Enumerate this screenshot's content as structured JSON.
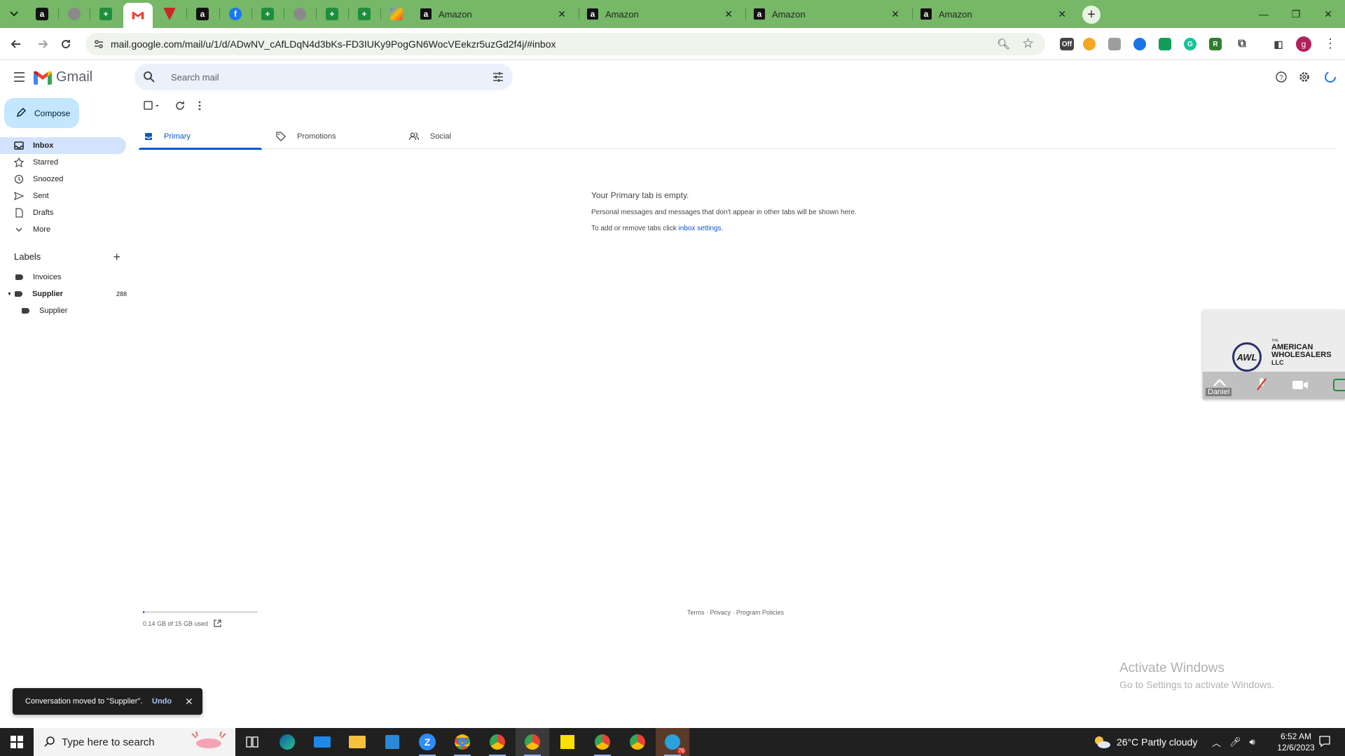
{
  "browser": {
    "pinned_tabs": [
      {
        "icon": "amazon-icon"
      },
      {
        "icon": "globe-icon"
      },
      {
        "icon": "sheets-plus-icon"
      },
      {
        "icon": "gmail-icon",
        "active": true
      },
      {
        "icon": "red-shield-icon"
      },
      {
        "icon": "amazon-icon"
      },
      {
        "icon": "facebook-icon"
      },
      {
        "icon": "sheets-plus-icon"
      },
      {
        "icon": "globe-icon"
      },
      {
        "icon": "sheets-plus-icon"
      },
      {
        "icon": "sheets-plus-icon"
      },
      {
        "icon": "colorful-app-icon"
      }
    ],
    "tabs": [
      {
        "title": "Amazon"
      },
      {
        "title": "Amazon"
      },
      {
        "title": "Amazon"
      },
      {
        "title": "Amazon"
      }
    ],
    "url": "mail.google.com/mail/u/1/d/ADwNV_cAfLDqN4d3bKs-FD3IUKy9PogGN6WocVEekzr5uzGd2f4j/#inbox",
    "profile_initial": "g",
    "accent_color": "#76b768"
  },
  "gmail": {
    "logo_text": "Gmail",
    "search_placeholder": "Search mail",
    "compose_label": "Compose",
    "nav": [
      {
        "label": "Inbox",
        "icon": "inbox-icon",
        "active": true
      },
      {
        "label": "Starred",
        "icon": "star-icon"
      },
      {
        "label": "Snoozed",
        "icon": "clock-icon"
      },
      {
        "label": "Sent",
        "icon": "send-icon"
      },
      {
        "label": "Drafts",
        "icon": "draft-icon"
      },
      {
        "label": "More",
        "icon": "chevron-down-icon"
      }
    ],
    "labels_title": "Labels",
    "labels": [
      {
        "name": "Invoices"
      },
      {
        "name": "Supplier",
        "count": "288",
        "bold": true,
        "expanded": true
      },
      {
        "name": "Supplier",
        "child": true
      }
    ],
    "tabs": [
      {
        "label": "Primary",
        "icon": "inbox-icon",
        "active": true
      },
      {
        "label": "Promotions",
        "icon": "tag-icon"
      },
      {
        "label": "Social",
        "icon": "people-icon"
      }
    ],
    "empty": {
      "title": "Your Primary tab is empty.",
      "line1": "Personal messages and messages that don't appear in other tabs will be shown here.",
      "line2_prefix": "To add or remove tabs click ",
      "line2_link": "inbox settings",
      "line2_suffix": "."
    },
    "storage": {
      "text": "0.14 GB of 15 GB used",
      "fraction": 0.0093
    },
    "footer": "Terms · Privacy · Program Policies",
    "snackbar": {
      "message": "Conversation moved to \"Supplier\".",
      "undo": "Undo"
    },
    "brand_blue": "#0b57d0"
  },
  "pip": {
    "brand_small": "THE",
    "brand_line1": "AMERICAN",
    "brand_line2": "WHOLESALERS",
    "brand_line3": "LLC",
    "logo_initials": "AWL",
    "participant": "Daniel"
  },
  "watermark": {
    "line1": "Activate Windows",
    "line2": "Go to Settings to activate Windows."
  },
  "taskbar": {
    "search_placeholder": "Type here to search",
    "weather": "26°C  Partly cloudy",
    "time": "6:52 AM",
    "date": "12/6/2023",
    "telegram_badge": "76"
  }
}
